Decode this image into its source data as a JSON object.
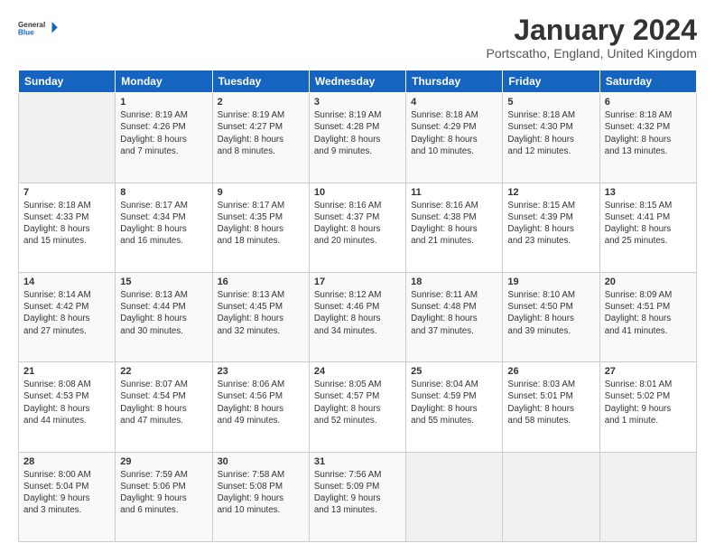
{
  "header": {
    "logo_line1": "General",
    "logo_line2": "Blue",
    "month_title": "January 2024",
    "location": "Portscatho, England, United Kingdom"
  },
  "days_of_week": [
    "Sunday",
    "Monday",
    "Tuesday",
    "Wednesday",
    "Thursday",
    "Friday",
    "Saturday"
  ],
  "weeks": [
    [
      {
        "day": "",
        "info": ""
      },
      {
        "day": "1",
        "info": "Sunrise: 8:19 AM\nSunset: 4:26 PM\nDaylight: 8 hours\nand 7 minutes."
      },
      {
        "day": "2",
        "info": "Sunrise: 8:19 AM\nSunset: 4:27 PM\nDaylight: 8 hours\nand 8 minutes."
      },
      {
        "day": "3",
        "info": "Sunrise: 8:19 AM\nSunset: 4:28 PM\nDaylight: 8 hours\nand 9 minutes."
      },
      {
        "day": "4",
        "info": "Sunrise: 8:18 AM\nSunset: 4:29 PM\nDaylight: 8 hours\nand 10 minutes."
      },
      {
        "day": "5",
        "info": "Sunrise: 8:18 AM\nSunset: 4:30 PM\nDaylight: 8 hours\nand 12 minutes."
      },
      {
        "day": "6",
        "info": "Sunrise: 8:18 AM\nSunset: 4:32 PM\nDaylight: 8 hours\nand 13 minutes."
      }
    ],
    [
      {
        "day": "7",
        "info": "Sunrise: 8:18 AM\nSunset: 4:33 PM\nDaylight: 8 hours\nand 15 minutes."
      },
      {
        "day": "8",
        "info": "Sunrise: 8:17 AM\nSunset: 4:34 PM\nDaylight: 8 hours\nand 16 minutes."
      },
      {
        "day": "9",
        "info": "Sunrise: 8:17 AM\nSunset: 4:35 PM\nDaylight: 8 hours\nand 18 minutes."
      },
      {
        "day": "10",
        "info": "Sunrise: 8:16 AM\nSunset: 4:37 PM\nDaylight: 8 hours\nand 20 minutes."
      },
      {
        "day": "11",
        "info": "Sunrise: 8:16 AM\nSunset: 4:38 PM\nDaylight: 8 hours\nand 21 minutes."
      },
      {
        "day": "12",
        "info": "Sunrise: 8:15 AM\nSunset: 4:39 PM\nDaylight: 8 hours\nand 23 minutes."
      },
      {
        "day": "13",
        "info": "Sunrise: 8:15 AM\nSunset: 4:41 PM\nDaylight: 8 hours\nand 25 minutes."
      }
    ],
    [
      {
        "day": "14",
        "info": "Sunrise: 8:14 AM\nSunset: 4:42 PM\nDaylight: 8 hours\nand 27 minutes."
      },
      {
        "day": "15",
        "info": "Sunrise: 8:13 AM\nSunset: 4:44 PM\nDaylight: 8 hours\nand 30 minutes."
      },
      {
        "day": "16",
        "info": "Sunrise: 8:13 AM\nSunset: 4:45 PM\nDaylight: 8 hours\nand 32 minutes."
      },
      {
        "day": "17",
        "info": "Sunrise: 8:12 AM\nSunset: 4:46 PM\nDaylight: 8 hours\nand 34 minutes."
      },
      {
        "day": "18",
        "info": "Sunrise: 8:11 AM\nSunset: 4:48 PM\nDaylight: 8 hours\nand 37 minutes."
      },
      {
        "day": "19",
        "info": "Sunrise: 8:10 AM\nSunset: 4:50 PM\nDaylight: 8 hours\nand 39 minutes."
      },
      {
        "day": "20",
        "info": "Sunrise: 8:09 AM\nSunset: 4:51 PM\nDaylight: 8 hours\nand 41 minutes."
      }
    ],
    [
      {
        "day": "21",
        "info": "Sunrise: 8:08 AM\nSunset: 4:53 PM\nDaylight: 8 hours\nand 44 minutes."
      },
      {
        "day": "22",
        "info": "Sunrise: 8:07 AM\nSunset: 4:54 PM\nDaylight: 8 hours\nand 47 minutes."
      },
      {
        "day": "23",
        "info": "Sunrise: 8:06 AM\nSunset: 4:56 PM\nDaylight: 8 hours\nand 49 minutes."
      },
      {
        "day": "24",
        "info": "Sunrise: 8:05 AM\nSunset: 4:57 PM\nDaylight: 8 hours\nand 52 minutes."
      },
      {
        "day": "25",
        "info": "Sunrise: 8:04 AM\nSunset: 4:59 PM\nDaylight: 8 hours\nand 55 minutes."
      },
      {
        "day": "26",
        "info": "Sunrise: 8:03 AM\nSunset: 5:01 PM\nDaylight: 8 hours\nand 58 minutes."
      },
      {
        "day": "27",
        "info": "Sunrise: 8:01 AM\nSunset: 5:02 PM\nDaylight: 9 hours\nand 1 minute."
      }
    ],
    [
      {
        "day": "28",
        "info": "Sunrise: 8:00 AM\nSunset: 5:04 PM\nDaylight: 9 hours\nand 3 minutes."
      },
      {
        "day": "29",
        "info": "Sunrise: 7:59 AM\nSunset: 5:06 PM\nDaylight: 9 hours\nand 6 minutes."
      },
      {
        "day": "30",
        "info": "Sunrise: 7:58 AM\nSunset: 5:08 PM\nDaylight: 9 hours\nand 10 minutes."
      },
      {
        "day": "31",
        "info": "Sunrise: 7:56 AM\nSunset: 5:09 PM\nDaylight: 9 hours\nand 13 minutes."
      },
      {
        "day": "",
        "info": ""
      },
      {
        "day": "",
        "info": ""
      },
      {
        "day": "",
        "info": ""
      }
    ]
  ]
}
